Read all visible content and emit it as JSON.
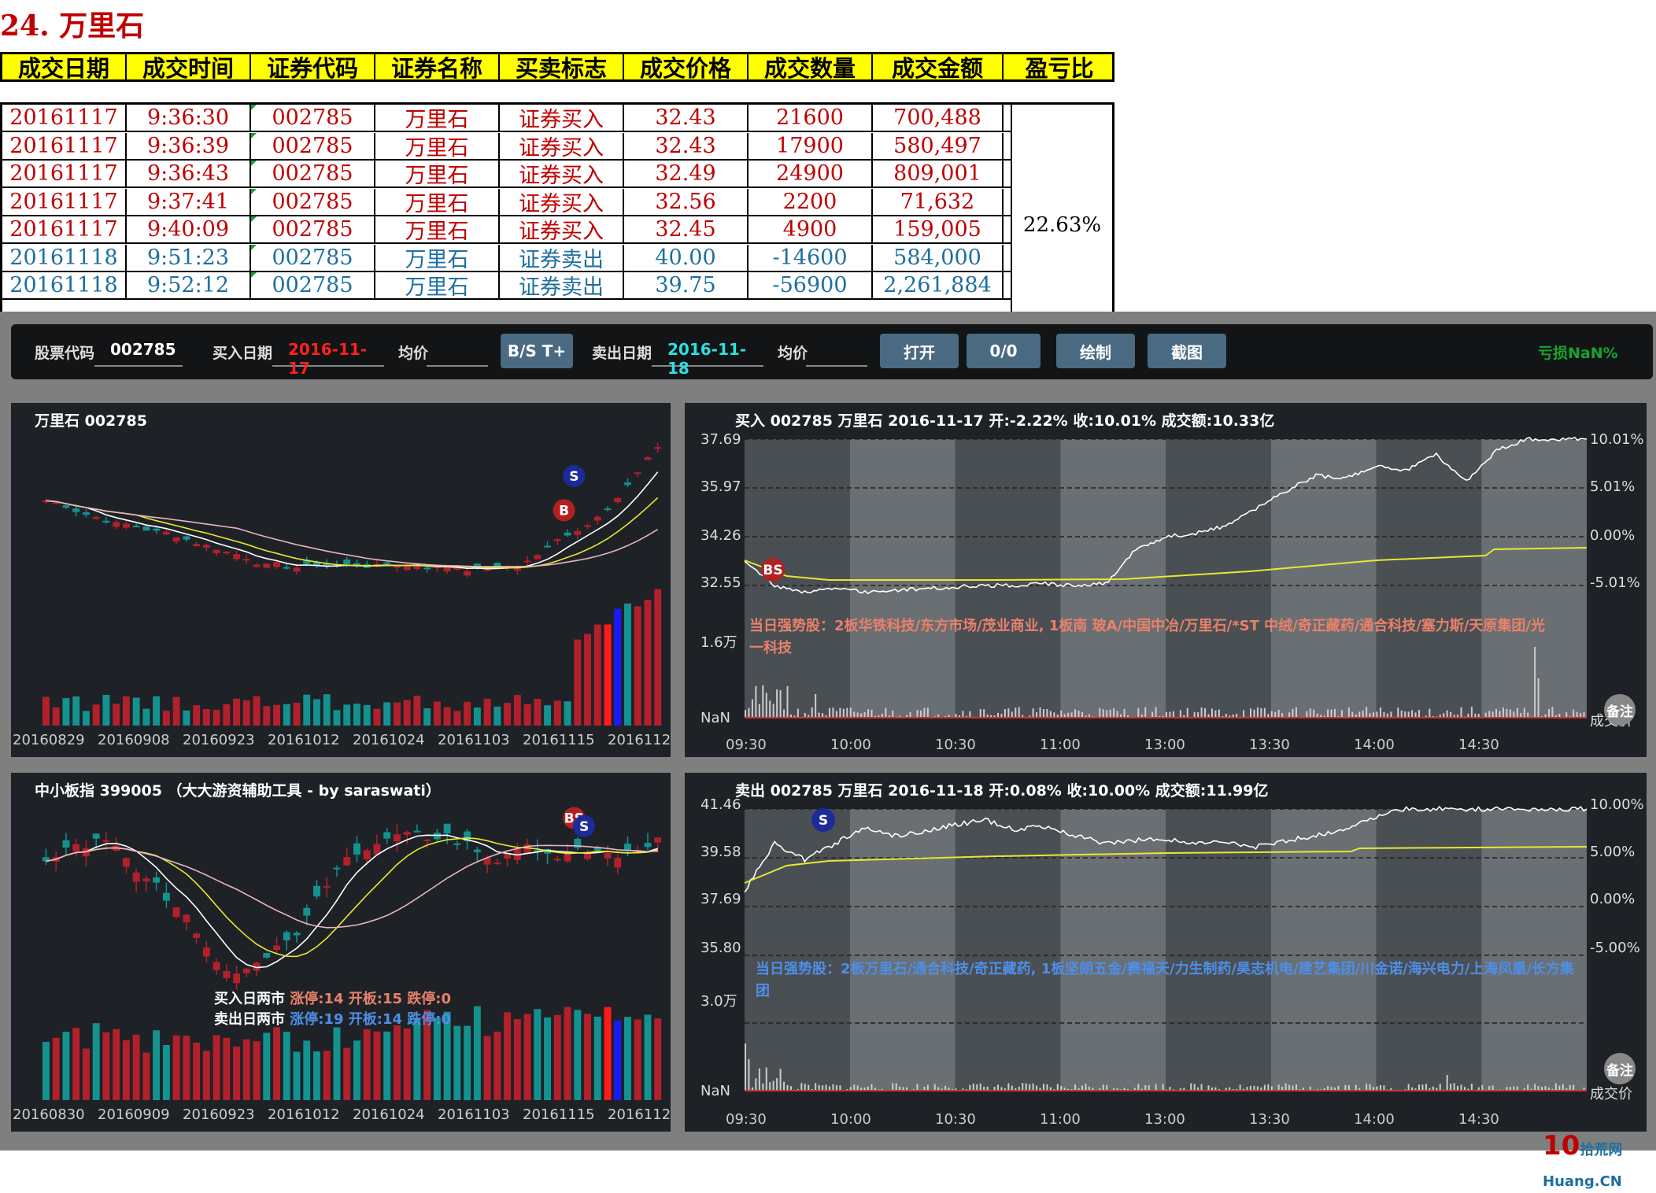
{
  "title": "24. 万里石",
  "table": {
    "headers": [
      "成交日期",
      "成交时间",
      "证券代码",
      "证券名称",
      "买卖标志",
      "成交价格",
      "成交数量",
      "成交金额",
      "盈亏比"
    ],
    "rows": [
      [
        "20161117",
        "9:36:30",
        "002785",
        "万里石",
        "证券买入",
        "32.43",
        "21600",
        "700,488"
      ],
      [
        "20161117",
        "9:36:39",
        "002785",
        "万里石",
        "证券买入",
        "32.43",
        "17900",
        "580,497"
      ],
      [
        "20161117",
        "9:36:43",
        "002785",
        "万里石",
        "证券买入",
        "32.49",
        "24900",
        "809,001"
      ],
      [
        "20161117",
        "9:37:41",
        "002785",
        "万里石",
        "证券买入",
        "32.56",
        "2200",
        "71,632"
      ],
      [
        "20161117",
        "9:40:09",
        "002785",
        "万里石",
        "证券买入",
        "32.45",
        "4900",
        "159,005"
      ],
      [
        "20161118",
        "9:51:23",
        "002785",
        "万里石",
        "证券卖出",
        "40.00",
        "-14600",
        "584,000"
      ],
      [
        "20161118",
        "9:52:12",
        "002785",
        "万里石",
        "证券卖出",
        "39.75",
        "-56900",
        "2,261,884"
      ]
    ],
    "ratio": "22.63%"
  },
  "toolbar": {
    "code_label": "股票代码",
    "code_value": "002785",
    "buy_date_label": "买入日期",
    "buy_date_value": "2016-11-17",
    "avg_label_1": "均价",
    "avg_value_1": "",
    "bst_btn": "B/S T+",
    "sell_date_label": "卖出日期",
    "sell_date_value": "2016-11-18",
    "avg_label_2": "均价",
    "avg_value_2": "",
    "open_btn": "打开",
    "count_btn": "0/0",
    "draw_btn": "绘制",
    "shot_btn": "截图",
    "pnl": "亏损NaN%"
  },
  "colors": {
    "buy_red": "#c00000",
    "sell_blue": "#1e6f9f",
    "up": "#b2202c",
    "down": "#13928f",
    "ma_white": "#ffffff",
    "ma_yellow": "#e8e830",
    "ma_pink": "#e8b4c0"
  },
  "markers": {
    "buy": "B",
    "sell": "S",
    "both": "BS"
  },
  "panels": {
    "stock": {
      "title": "万里石 002785",
      "x_labels": [
        "20160829",
        "20160908",
        "20160923",
        "20161012",
        "20161024",
        "20161103",
        "20161115",
        "2016112"
      ]
    },
    "buy_day": {
      "title": "买入 002785 万里石 2016-11-17 开:-2.22% 收:10.01% 成交额:10.33亿",
      "y_left": [
        "37.69",
        "35.97",
        "34.26",
        "32.55",
        "1.6万",
        "NaN"
      ],
      "y_right": [
        "10.01%",
        "5.01%",
        "0.00%",
        "-5.01%",
        "成交价"
      ],
      "x_labels": [
        "09:30",
        "10:00",
        "10:30",
        "11:00",
        "13:00",
        "13:30",
        "14:00",
        "14:30"
      ],
      "note": "当日强势股：2板华铁科技/东方市场/茂业商业, 1板南 玻A/中国中冶/万里石/*ST 中绒/奇正藏药/通合科技/塞力斯/天原集团/光一科技",
      "beizhu": "备注"
    },
    "index": {
      "title": "中小板指 399005 （大大游资辅助工具 - by saraswati）",
      "x_labels": [
        "20160830",
        "20160909",
        "20160923",
        "20161012",
        "20161024",
        "20161103",
        "20161115",
        "2016112"
      ],
      "buy_market_label": "买入日两市",
      "buy_market_stats": "涨停:14 开板:15 跌停:0",
      "sell_market_label": "卖出日两市",
      "sell_market_stats": "涨停:19 开板:14 跌停:0"
    },
    "sell_day": {
      "title": "卖出 002785 万里石 2016-11-18 开:0.08% 收:10.00% 成交额:11.99亿",
      "y_left": [
        "41.46",
        "39.58",
        "37.69",
        "35.80",
        "3.0万",
        "NaN"
      ],
      "y_right": [
        "10.00%",
        "5.00%",
        "0.00%",
        "-5.00%",
        "成交价"
      ],
      "x_labels": [
        "09:30",
        "10:00",
        "10:30",
        "11:00",
        "13:00",
        "13:30",
        "14:00",
        "14:30"
      ],
      "note": "当日强势股：2板万里石/通合科技/奇正藏药, 1板坚朗五金/赛福天/力生制药/昊志机电/建艺集团/川金诺/海兴电力/上海凤凰/长方集团",
      "beizhu": "备注"
    }
  },
  "watermark": {
    "main": "10",
    "sub": "拾荒网 Huang.CN"
  }
}
